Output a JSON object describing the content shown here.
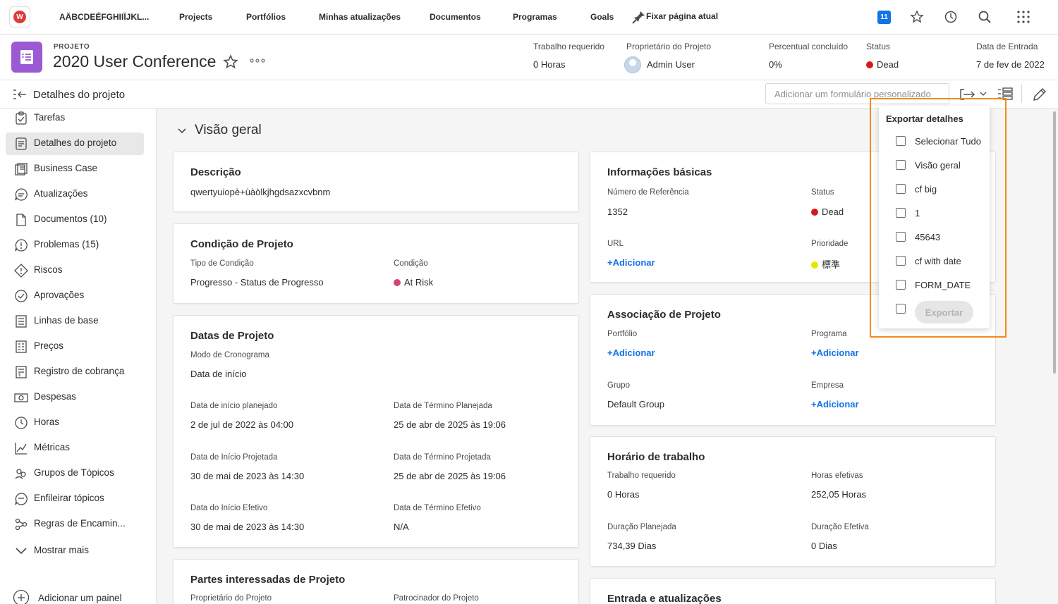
{
  "topnav": {
    "org": "AÄBCDEÉFGHIIÏJKL...",
    "items": [
      "Projects",
      "Portfólios",
      "Minhas atualizações",
      "Documentos",
      "Programas",
      "Goals",
      "Fixar página atual"
    ],
    "notifications": "11"
  },
  "project": {
    "label": "PROJETO",
    "title": "2020 User Conference",
    "meta": [
      {
        "label": "Trabalho requerido",
        "value": "0 Horas"
      },
      {
        "label": "Proprietário do Projeto",
        "value": "Admin User"
      },
      {
        "label": "Percentual concluído",
        "value": "0%"
      },
      {
        "label": "Status",
        "value": "Dead"
      },
      {
        "label": "Data de Entrada",
        "value": "7 de fev de 2022"
      }
    ]
  },
  "subbar": {
    "title": "Detalhes do projeto",
    "custom_form_placeholder": "Adicionar um formulário personalizado"
  },
  "sidebar": {
    "items": [
      "Tarefas",
      "Detalhes do projeto",
      "Business Case",
      "Atualizações",
      "Documentos (10)",
      "Problemas (15)",
      "Riscos",
      "Aprovações",
      "Linhas de base",
      "Preços",
      "Registro de cobrança",
      "Despesas",
      "Horas",
      "Métricas",
      "Grupos de Tópicos",
      "Enfileirar tópicos",
      "Regras de Encamin...",
      "Mostrar mais"
    ],
    "add_panel": "Adicionar um painel"
  },
  "overview": {
    "title": "Visão geral",
    "descricao": {
      "title": "Descrição",
      "value": "qwertyuiopè+ùàòlkjhgdsazxcvbnm"
    },
    "condicao": {
      "title": "Condição de Projeto",
      "tipo_label": "Tipo de Condição",
      "tipo_value": "Progresso - Status de Progresso",
      "cond_label": "Condição",
      "cond_value": "At Risk"
    },
    "datas": {
      "title": "Datas de Projeto",
      "modo_label": "Modo de Cronograma",
      "modo_value": "Data de início",
      "f1_label": "Data de início planejado",
      "f1_value": "2 de jul de 2022 às 04:00",
      "f2_label": "Data de Término Planejada",
      "f2_value": "25 de abr de 2025 às 19:06",
      "f3_label": "Data de Início Projetada",
      "f3_value": "30 de mai de 2023 às 14:30",
      "f4_label": "Data de Término Projetada",
      "f4_value": "25 de abr de 2025 às 19:06",
      "f5_label": "Data do Início Efetivo",
      "f5_value": "30 de mai de 2023 às 14:30",
      "f6_label": "Data de Término Efetivo",
      "f6_value": "N/A"
    },
    "partes": {
      "title": "Partes interessadas de Projeto",
      "owner_label": "Proprietário do Projeto",
      "sponsor_label": "Patrocinador do Projeto"
    },
    "basicas": {
      "title": "Informações básicas",
      "ref_label": "Número de Referência",
      "ref_value": "1352",
      "status_label": "Status",
      "status_value": "Dead",
      "url_label": "URL",
      "url_value": "+Adicionar",
      "prio_label": "Prioridade",
      "prio_value": "標準"
    },
    "associacao": {
      "title": "Associação de Projeto",
      "port_label": "Portfólio",
      "port_value": "+Adicionar",
      "prog_label": "Programa",
      "prog_value": "+Adicionar",
      "grupo_label": "Grupo",
      "grupo_value": "Default Group",
      "emp_label": "Empresa",
      "emp_value": "+Adicionar"
    },
    "horario": {
      "title": "Horário de trabalho",
      "req_label": "Trabalho requerido",
      "req_value": "0 Horas",
      "ef_label": "Horas efetivas",
      "ef_value": "252,05 Horas",
      "dp_label": "Duração Planejada",
      "dp_value": "734,39 Dias",
      "de_label": "Duração Efetiva",
      "de_value": "0 Dias"
    },
    "entrada": {
      "title": "Entrada e atualizações"
    }
  },
  "export": {
    "title": "Exportar detalhes",
    "options": [
      "Selecionar Tudo",
      "Visão geral",
      "cf big",
      "1",
      "45643",
      "cf with date",
      "FORM_DATE",
      ""
    ],
    "button": "Exportar"
  },
  "colors": {
    "accent": "#1473e6",
    "dead": "#d7191c",
    "at_risk": "#d8417c",
    "priority": "#e6e600",
    "project_icon": "#9b59d4",
    "highlight": "#f08c1a"
  }
}
